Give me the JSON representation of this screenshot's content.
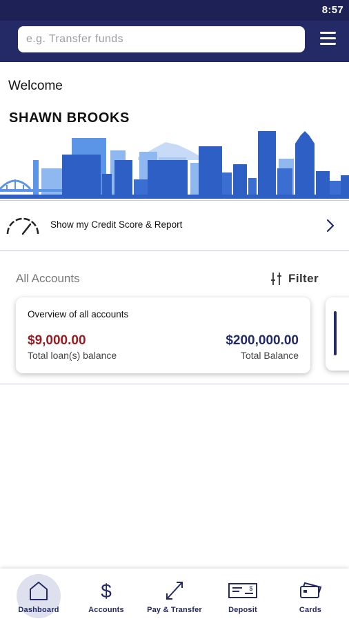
{
  "status_bar": {
    "time": "8:57"
  },
  "header": {
    "search_placeholder": "e.g. Transfer funds",
    "menu_icon": "hamburger-menu-icon"
  },
  "welcome": {
    "greeting": "Welcome",
    "user_name": "SHAWN BROOKS"
  },
  "credit": {
    "label": "Show my Credit Score & Report",
    "icon": "gauge-icon"
  },
  "accounts": {
    "title": "All Accounts",
    "filter_label": "Filter",
    "overview_card": {
      "title": "Overview of all accounts",
      "loan_amount": "$9,000.00",
      "loan_label": "Total loan(s) balance",
      "total_amount": "$200,000.00",
      "total_label": "Total Balance"
    }
  },
  "bottom_nav": {
    "items": [
      {
        "label": "Dashboard",
        "icon": "home-icon",
        "active": true
      },
      {
        "label": "Accounts",
        "icon": "dollar-icon",
        "active": false
      },
      {
        "label": "Pay & Transfer",
        "icon": "transfer-arrows-icon",
        "active": false
      },
      {
        "label": "Deposit",
        "icon": "check-icon",
        "active": false
      },
      {
        "label": "Cards",
        "icon": "cards-icon",
        "active": false
      }
    ]
  },
  "colors": {
    "brand_navy": "#242a66",
    "status_bar": "#1e2155",
    "loan_red": "#9b1a1f",
    "skyline_blue": "#2d5fc4",
    "skyline_light": "#8fb8f0"
  }
}
